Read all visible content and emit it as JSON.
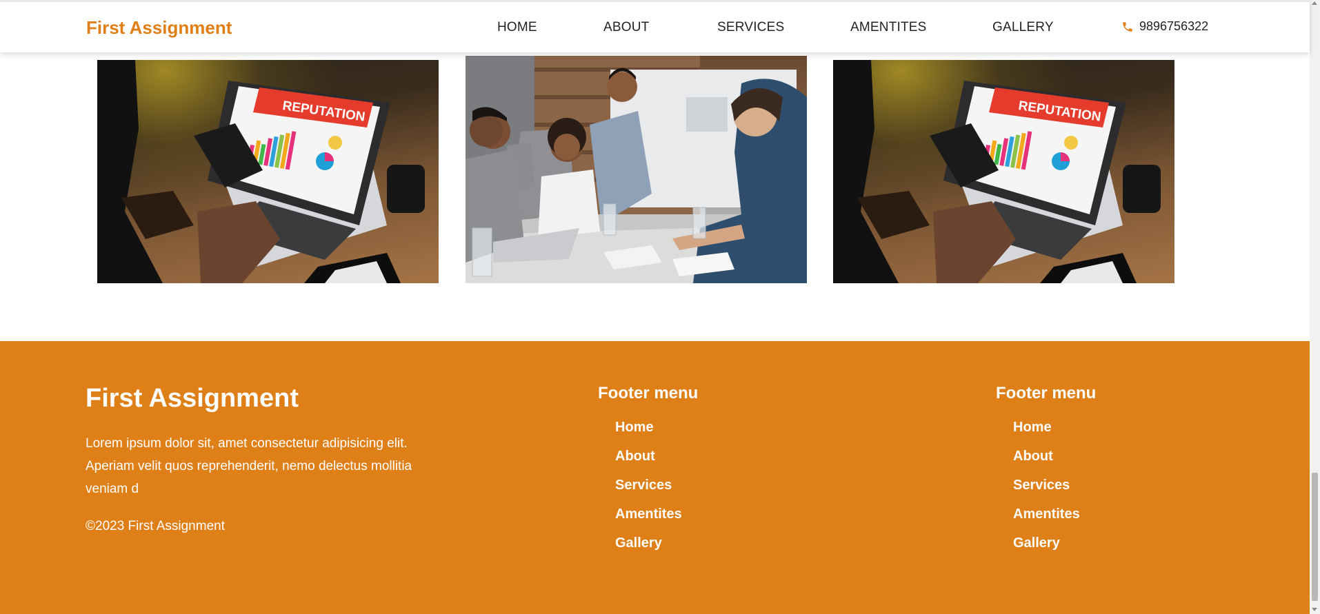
{
  "header": {
    "brand": "First Assignment",
    "nav": [
      "HOME",
      "ABOUT",
      "SERVICES",
      "AMENTITES",
      "GALLERY"
    ],
    "phone": "9896756322",
    "phone_icon": "phone-icon",
    "accent_color": "#e07f17"
  },
  "gallery": {
    "images": [
      {
        "subject": "laptop-reputation",
        "caption": "REPUTATION"
      },
      {
        "subject": "team-meeting",
        "caption": ""
      },
      {
        "subject": "laptop-reputation",
        "caption": "REPUTATION"
      }
    ]
  },
  "footer": {
    "title": "First Assignment",
    "text": "Lorem ipsum dolor sit, amet consectetur adipisicing elit. Aperiam velit quos reprehenderit, nemo delectus mollitia veniam d",
    "copyright": "©2023 First Assignment",
    "background_color": "#df7f18",
    "menus": [
      {
        "heading": "Footer menu",
        "items": [
          "Home",
          "About",
          "Services",
          "Amentites",
          "Gallery"
        ]
      },
      {
        "heading": "Footer menu",
        "items": [
          "Home",
          "About",
          "Services",
          "Amentites",
          "Gallery"
        ]
      }
    ]
  }
}
